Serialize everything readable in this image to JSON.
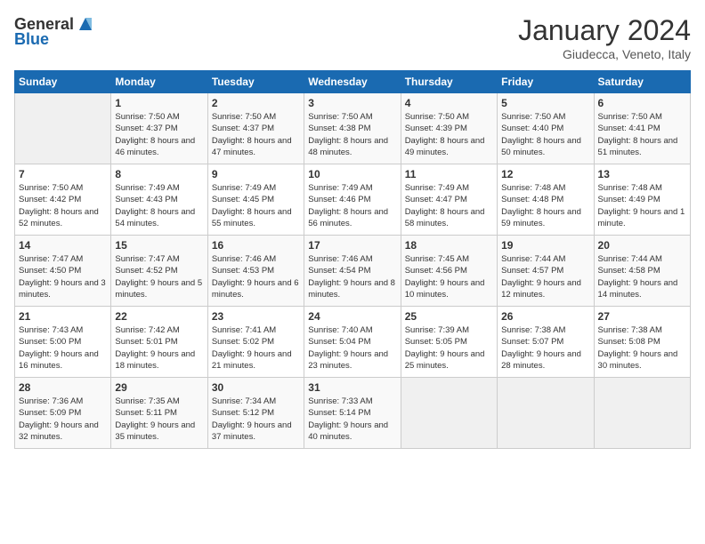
{
  "header": {
    "logo_general": "General",
    "logo_blue": "Blue",
    "title": "January 2024",
    "subtitle": "Giudecca, Veneto, Italy"
  },
  "weekdays": [
    "Sunday",
    "Monday",
    "Tuesday",
    "Wednesday",
    "Thursday",
    "Friday",
    "Saturday"
  ],
  "weeks": [
    [
      {
        "day": "",
        "sunrise": "",
        "sunset": "",
        "daylight": ""
      },
      {
        "day": "1",
        "sunrise": "Sunrise: 7:50 AM",
        "sunset": "Sunset: 4:37 PM",
        "daylight": "Daylight: 8 hours and 46 minutes."
      },
      {
        "day": "2",
        "sunrise": "Sunrise: 7:50 AM",
        "sunset": "Sunset: 4:37 PM",
        "daylight": "Daylight: 8 hours and 47 minutes."
      },
      {
        "day": "3",
        "sunrise": "Sunrise: 7:50 AM",
        "sunset": "Sunset: 4:38 PM",
        "daylight": "Daylight: 8 hours and 48 minutes."
      },
      {
        "day": "4",
        "sunrise": "Sunrise: 7:50 AM",
        "sunset": "Sunset: 4:39 PM",
        "daylight": "Daylight: 8 hours and 49 minutes."
      },
      {
        "day": "5",
        "sunrise": "Sunrise: 7:50 AM",
        "sunset": "Sunset: 4:40 PM",
        "daylight": "Daylight: 8 hours and 50 minutes."
      },
      {
        "day": "6",
        "sunrise": "Sunrise: 7:50 AM",
        "sunset": "Sunset: 4:41 PM",
        "daylight": "Daylight: 8 hours and 51 minutes."
      }
    ],
    [
      {
        "day": "7",
        "sunrise": "Sunrise: 7:50 AM",
        "sunset": "Sunset: 4:42 PM",
        "daylight": "Daylight: 8 hours and 52 minutes."
      },
      {
        "day": "8",
        "sunrise": "Sunrise: 7:49 AM",
        "sunset": "Sunset: 4:43 PM",
        "daylight": "Daylight: 8 hours and 54 minutes."
      },
      {
        "day": "9",
        "sunrise": "Sunrise: 7:49 AM",
        "sunset": "Sunset: 4:45 PM",
        "daylight": "Daylight: 8 hours and 55 minutes."
      },
      {
        "day": "10",
        "sunrise": "Sunrise: 7:49 AM",
        "sunset": "Sunset: 4:46 PM",
        "daylight": "Daylight: 8 hours and 56 minutes."
      },
      {
        "day": "11",
        "sunrise": "Sunrise: 7:49 AM",
        "sunset": "Sunset: 4:47 PM",
        "daylight": "Daylight: 8 hours and 58 minutes."
      },
      {
        "day": "12",
        "sunrise": "Sunrise: 7:48 AM",
        "sunset": "Sunset: 4:48 PM",
        "daylight": "Daylight: 8 hours and 59 minutes."
      },
      {
        "day": "13",
        "sunrise": "Sunrise: 7:48 AM",
        "sunset": "Sunset: 4:49 PM",
        "daylight": "Daylight: 9 hours and 1 minute."
      }
    ],
    [
      {
        "day": "14",
        "sunrise": "Sunrise: 7:47 AM",
        "sunset": "Sunset: 4:50 PM",
        "daylight": "Daylight: 9 hours and 3 minutes."
      },
      {
        "day": "15",
        "sunrise": "Sunrise: 7:47 AM",
        "sunset": "Sunset: 4:52 PM",
        "daylight": "Daylight: 9 hours and 5 minutes."
      },
      {
        "day": "16",
        "sunrise": "Sunrise: 7:46 AM",
        "sunset": "Sunset: 4:53 PM",
        "daylight": "Daylight: 9 hours and 6 minutes."
      },
      {
        "day": "17",
        "sunrise": "Sunrise: 7:46 AM",
        "sunset": "Sunset: 4:54 PM",
        "daylight": "Daylight: 9 hours and 8 minutes."
      },
      {
        "day": "18",
        "sunrise": "Sunrise: 7:45 AM",
        "sunset": "Sunset: 4:56 PM",
        "daylight": "Daylight: 9 hours and 10 minutes."
      },
      {
        "day": "19",
        "sunrise": "Sunrise: 7:44 AM",
        "sunset": "Sunset: 4:57 PM",
        "daylight": "Daylight: 9 hours and 12 minutes."
      },
      {
        "day": "20",
        "sunrise": "Sunrise: 7:44 AM",
        "sunset": "Sunset: 4:58 PM",
        "daylight": "Daylight: 9 hours and 14 minutes."
      }
    ],
    [
      {
        "day": "21",
        "sunrise": "Sunrise: 7:43 AM",
        "sunset": "Sunset: 5:00 PM",
        "daylight": "Daylight: 9 hours and 16 minutes."
      },
      {
        "day": "22",
        "sunrise": "Sunrise: 7:42 AM",
        "sunset": "Sunset: 5:01 PM",
        "daylight": "Daylight: 9 hours and 18 minutes."
      },
      {
        "day": "23",
        "sunrise": "Sunrise: 7:41 AM",
        "sunset": "Sunset: 5:02 PM",
        "daylight": "Daylight: 9 hours and 21 minutes."
      },
      {
        "day": "24",
        "sunrise": "Sunrise: 7:40 AM",
        "sunset": "Sunset: 5:04 PM",
        "daylight": "Daylight: 9 hours and 23 minutes."
      },
      {
        "day": "25",
        "sunrise": "Sunrise: 7:39 AM",
        "sunset": "Sunset: 5:05 PM",
        "daylight": "Daylight: 9 hours and 25 minutes."
      },
      {
        "day": "26",
        "sunrise": "Sunrise: 7:38 AM",
        "sunset": "Sunset: 5:07 PM",
        "daylight": "Daylight: 9 hours and 28 minutes."
      },
      {
        "day": "27",
        "sunrise": "Sunrise: 7:38 AM",
        "sunset": "Sunset: 5:08 PM",
        "daylight": "Daylight: 9 hours and 30 minutes."
      }
    ],
    [
      {
        "day": "28",
        "sunrise": "Sunrise: 7:36 AM",
        "sunset": "Sunset: 5:09 PM",
        "daylight": "Daylight: 9 hours and 32 minutes."
      },
      {
        "day": "29",
        "sunrise": "Sunrise: 7:35 AM",
        "sunset": "Sunset: 5:11 PM",
        "daylight": "Daylight: 9 hours and 35 minutes."
      },
      {
        "day": "30",
        "sunrise": "Sunrise: 7:34 AM",
        "sunset": "Sunset: 5:12 PM",
        "daylight": "Daylight: 9 hours and 37 minutes."
      },
      {
        "day": "31",
        "sunrise": "Sunrise: 7:33 AM",
        "sunset": "Sunset: 5:14 PM",
        "daylight": "Daylight: 9 hours and 40 minutes."
      },
      {
        "day": "",
        "sunrise": "",
        "sunset": "",
        "daylight": ""
      },
      {
        "day": "",
        "sunrise": "",
        "sunset": "",
        "daylight": ""
      },
      {
        "day": "",
        "sunrise": "",
        "sunset": "",
        "daylight": ""
      }
    ]
  ]
}
